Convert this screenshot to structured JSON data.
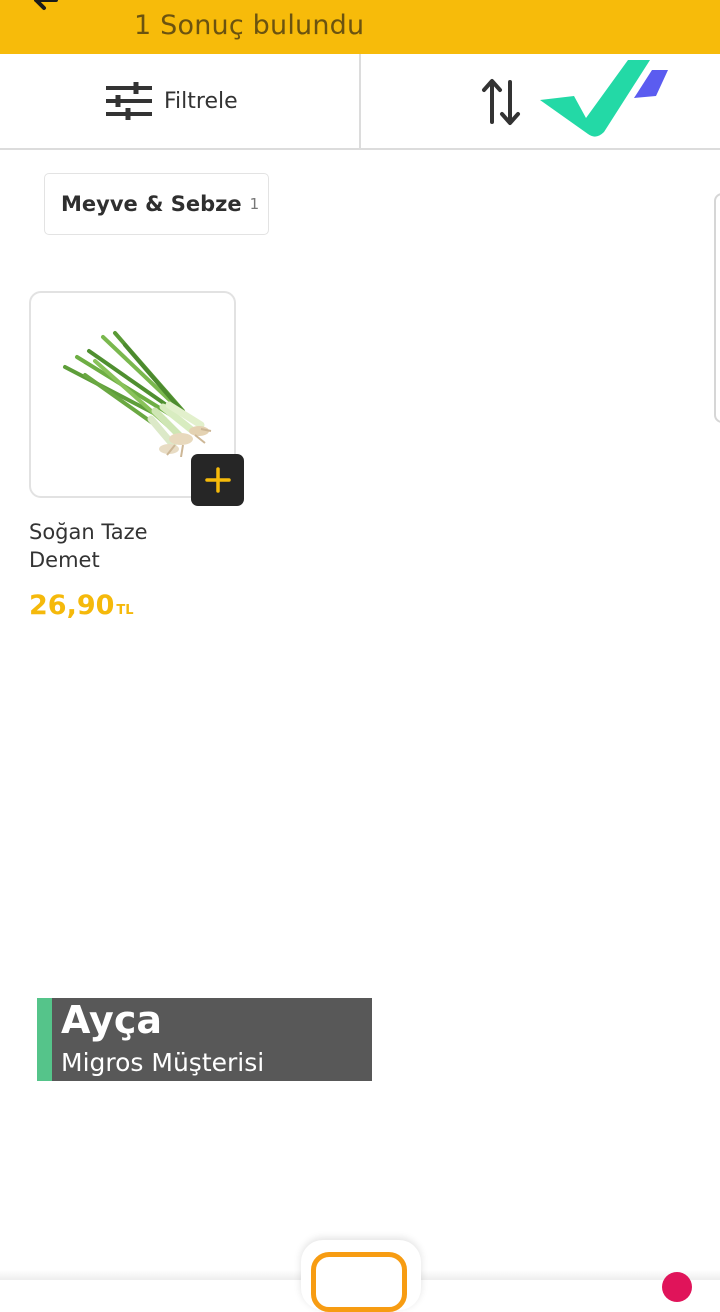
{
  "header": {
    "results_text": "1 Sonuç bulundu",
    "back_icon": "arrow-left-icon",
    "background_color": "#f7bb0a"
  },
  "toolbar": {
    "filter_label": "Filtrele",
    "filter_icon": "sliders-icon",
    "sort_icon": "sort-arrows-icon",
    "logo_icon": "brand-logo-mark"
  },
  "category_chip": {
    "label": "Meyve & Sebze",
    "count": "1"
  },
  "products": [
    {
      "name": "Soğan Taze Demet",
      "price": "26,90",
      "currency": "TL",
      "image_icon": "green-onion-image",
      "add_icon": "plus-icon"
    }
  ],
  "lower_third": {
    "name": "Ayça",
    "role": "Migros Müşterisi",
    "accent_color": "#55c48a"
  },
  "bottom_nav": {
    "basket_icon": "basket-icon",
    "accent_color": "#f79c12"
  }
}
